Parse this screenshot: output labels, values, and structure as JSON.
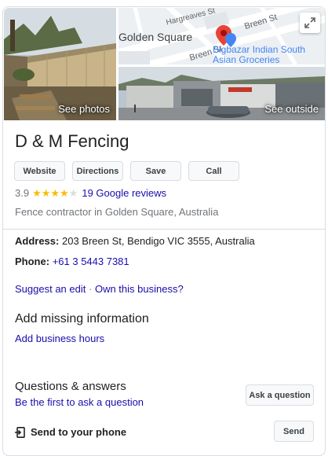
{
  "photos": {
    "see_photos_label": "See photos",
    "see_outside_label": "See outside",
    "map": {
      "streets": [
        "Hargreaves St",
        "Breen St",
        "Breen St"
      ],
      "suburb": "Golden Square",
      "place": "Bigbazar Indian South Asian Groceries",
      "pin_color": "#ea4335"
    }
  },
  "business": {
    "name": "D & M Fencing",
    "actions": [
      "Website",
      "Directions",
      "Save",
      "Call"
    ],
    "rating": "3.9",
    "stars_filled": 4,
    "star_color": "#fbbc04",
    "reviews_label": "19 Google reviews",
    "category": "Fence contractor in Golden Square, Australia"
  },
  "details": {
    "address_label": "Address:",
    "address_value": "203 Breen St, Bendigo VIC 3555, Australia",
    "phone_label": "Phone:",
    "phone_value": "+61 3 5443 7381",
    "suggest_edit": "Suggest an edit",
    "separator": "·",
    "own_business": "Own this business?"
  },
  "missing_info": {
    "title": "Add missing information",
    "link": "Add business hours"
  },
  "qa": {
    "title": "Questions & answers",
    "link": "Be the first to ask a question",
    "button": "Ask a question"
  },
  "send": {
    "label": "Send to your phone",
    "button": "Send"
  }
}
